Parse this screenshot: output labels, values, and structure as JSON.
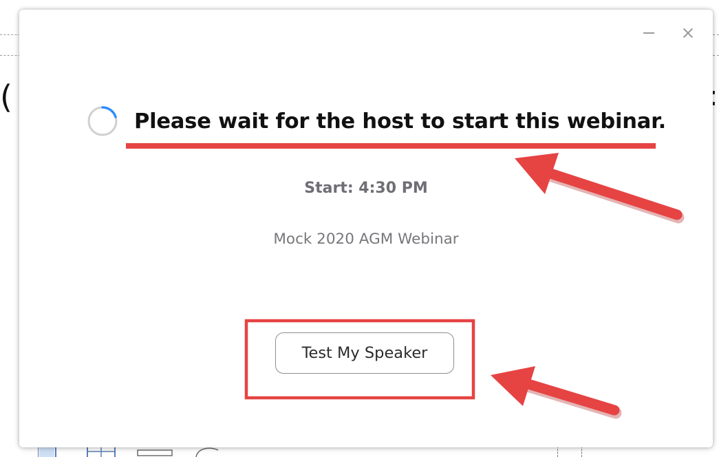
{
  "dialog": {
    "headline": "Please wait for the host to start this webinar.",
    "start_time": "Start: 4:30 PM",
    "webinar_name": "Mock 2020 AGM  Webinar",
    "test_speaker_label": "Test My Speaker"
  },
  "colors": {
    "annotation_red": "#e64343",
    "spinner_blue": "#2d8cff",
    "spinner_track": "#d0d0d0",
    "headline_text": "#111111",
    "muted_text": "#6e6e74"
  }
}
